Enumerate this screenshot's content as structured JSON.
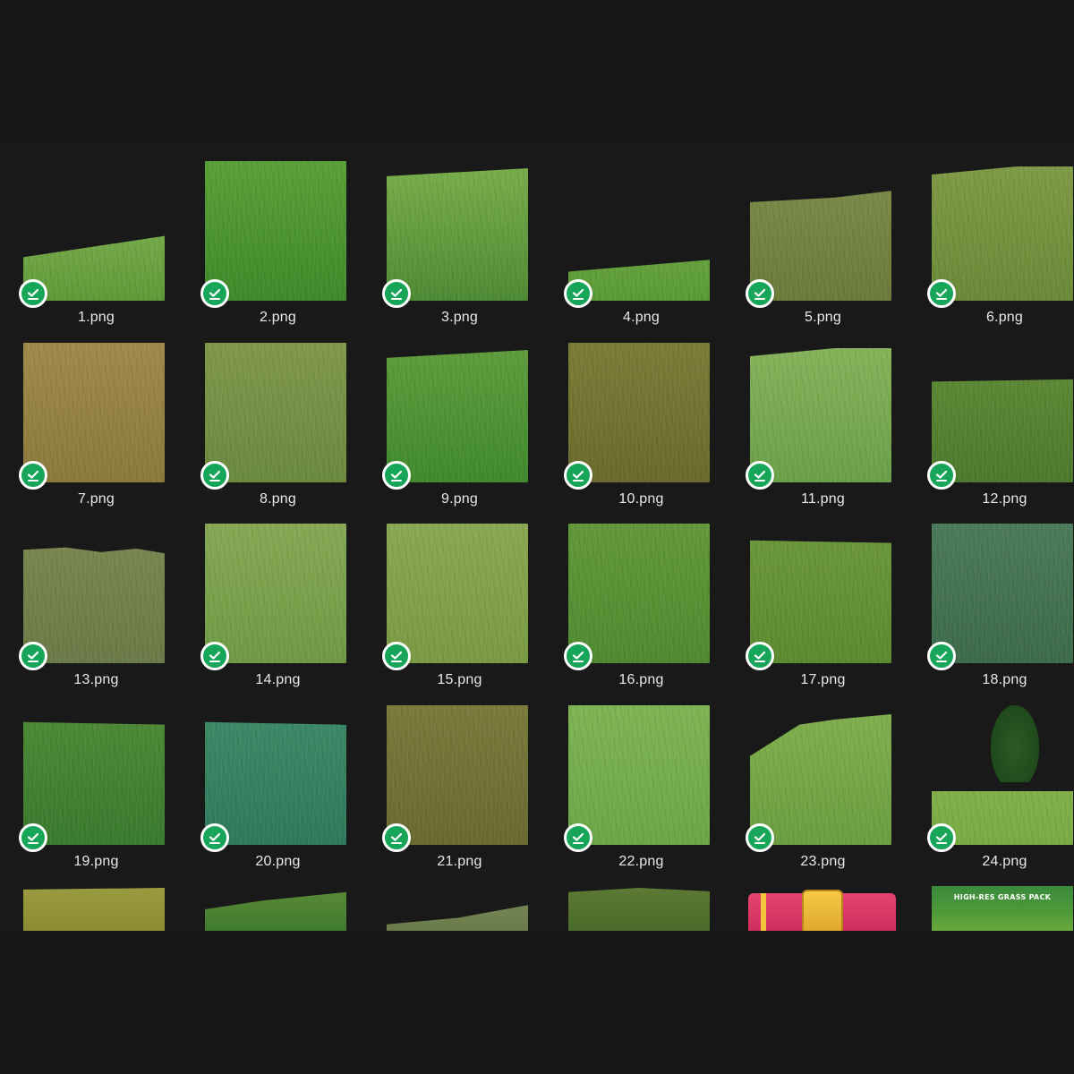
{
  "files": [
    {
      "name": "1.png",
      "status": "synced",
      "colors": [
        "#5f9a38",
        "#7fb052"
      ],
      "shape": "slope-low"
    },
    {
      "name": "2.png",
      "status": "synced",
      "colors": [
        "#3f8a2a",
        "#5aa038"
      ],
      "shape": "full-tall"
    },
    {
      "name": "3.png",
      "status": "synced",
      "colors": [
        "#4e8a34",
        "#78ad4a"
      ],
      "shape": "slope-mid"
    },
    {
      "name": "4.png",
      "status": "synced",
      "colors": [
        "#5a9a35",
        "#6fa845"
      ],
      "shape": "slope-low2"
    },
    {
      "name": "5.png",
      "status": "synced",
      "colors": [
        "#6c7a3a",
        "#7a8a48"
      ],
      "shape": "slope-mid2"
    },
    {
      "name": "6.png",
      "status": "synced",
      "colors": [
        "#6a8a38",
        "#7f9a46"
      ],
      "shape": "slope-high"
    },
    {
      "name": "7.png",
      "status": "synced",
      "colors": [
        "#8a7a3c",
        "#a08a4a"
      ],
      "shape": "full"
    },
    {
      "name": "8.png",
      "status": "synced",
      "colors": [
        "#6a8a3e",
        "#80984c"
      ],
      "shape": "full"
    },
    {
      "name": "9.png",
      "status": "synced",
      "colors": [
        "#3f8a2e",
        "#5f9c3c"
      ],
      "shape": "slope-mid"
    },
    {
      "name": "10.png",
      "status": "synced",
      "colors": [
        "#6a6a2c",
        "#7c7c38"
      ],
      "shape": "full"
    },
    {
      "name": "11.png",
      "status": "synced",
      "colors": [
        "#6aa048",
        "#86b25a"
      ],
      "shape": "slope-high"
    },
    {
      "name": "12.png",
      "status": "synced",
      "colors": [
        "#4c7a2c",
        "#5e8a36"
      ],
      "shape": "slope-low3"
    },
    {
      "name": "13.png",
      "status": "synced",
      "colors": [
        "#6b7a48",
        "#7a8650"
      ],
      "shape": "wavy"
    },
    {
      "name": "14.png",
      "status": "synced",
      "colors": [
        "#6f9a44",
        "#86a854"
      ],
      "shape": "full"
    },
    {
      "name": "15.png",
      "status": "synced",
      "colors": [
        "#7a9a44",
        "#8aa852"
      ],
      "shape": "full"
    },
    {
      "name": "16.png",
      "status": "synced",
      "colors": [
        "#4f8a30",
        "#62983a"
      ],
      "shape": "full"
    },
    {
      "name": "17.png",
      "status": "synced",
      "colors": [
        "#5c8a30",
        "#6c983c"
      ],
      "shape": "slope-flat"
    },
    {
      "name": "18.png",
      "status": "synced",
      "colors": [
        "#3c6a4a",
        "#4c7a5a"
      ],
      "shape": "full"
    },
    {
      "name": "19.png",
      "status": "synced",
      "colors": [
        "#3a7a2e",
        "#4e8a36"
      ],
      "shape": "slope-flat"
    },
    {
      "name": "20.png",
      "status": "synced",
      "colors": [
        "#2f7a5a",
        "#3c8a68"
      ],
      "shape": "slope-flat"
    },
    {
      "name": "21.png",
      "status": "synced",
      "colors": [
        "#6a6a30",
        "#7a7a3c"
      ],
      "shape": "full"
    },
    {
      "name": "22.png",
      "status": "synced",
      "colors": [
        "#6aa648",
        "#7fb454"
      ],
      "shape": "full"
    },
    {
      "name": "23.png",
      "status": "synced",
      "colors": [
        "#6a9e40",
        "#80ae4e"
      ],
      "shape": "hill"
    },
    {
      "name": "24.png",
      "status": "synced",
      "colors": [
        "#7aaa42",
        "#8cb852"
      ],
      "shape": "tree"
    }
  ],
  "partial_row": [
    {
      "colors": [
        "#8a8a34",
        "#9a9a40"
      ],
      "kind": "grass"
    },
    {
      "colors": [
        "#3f7a2c",
        "#5a8a38"
      ],
      "kind": "grass"
    },
    {
      "colors": [
        "#6a7a4a",
        "#7a8a56"
      ],
      "kind": "grass"
    },
    {
      "colors": [
        "#4a6a2a",
        "#5c7a34"
      ],
      "kind": "grass"
    },
    {
      "colors": [
        "#e64470",
        "#f5c845"
      ],
      "kind": "archive"
    },
    {
      "colors": [
        "#3a8a3c",
        "#6aa83c"
      ],
      "kind": "cover",
      "cover_text": "HIGH-RES GRASS PACK"
    }
  ],
  "icons": {
    "status_badge": "check-circle-icon",
    "badge_color": "#17a659"
  }
}
